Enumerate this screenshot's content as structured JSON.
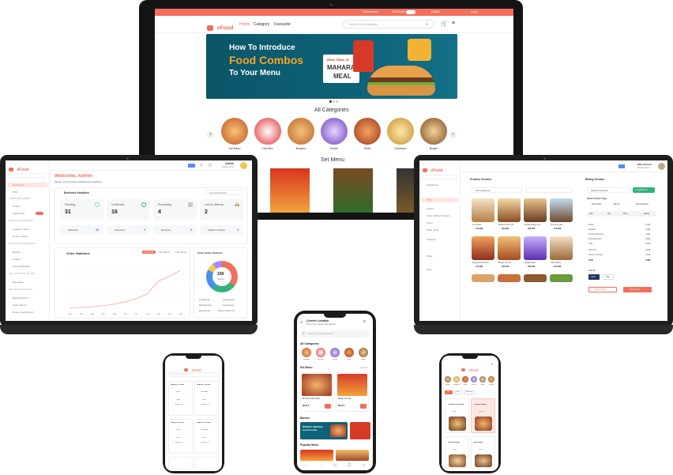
{
  "desktop": {
    "brand": "eFood",
    "nav": [
      "Home",
      "Category",
      "Favourite"
    ],
    "search_placeholder": "Search food & category...",
    "topbar": [
      "Restaurants",
      "Dark Mode",
      "English",
      "Login"
    ],
    "banner": {
      "line1": "How To Introduce",
      "line2": "Food Combos",
      "line3": "To Your Menu",
      "tag1": "REAL DEAL IS",
      "tag2": "MAHARAJA",
      "tag3": "MEAL"
    },
    "categories_title": "All Categories",
    "categories": [
      "Set Menu",
      "Hot Item",
      "Burgers",
      "Drinks",
      "Pizza",
      "Sandwich",
      "Burger"
    ],
    "set_menu_title": "Set Menu"
  },
  "admin": {
    "brand": "eFood",
    "welcome": "Welcome, Admin",
    "subtitle": "Monitor your business analytics and statistics",
    "analytics_title": "Business Analytics",
    "filter": "Overall Statistics",
    "user": "Admin",
    "role": "Master Admin",
    "stats": [
      {
        "label": "Pending",
        "value": "31"
      },
      {
        "label": "Confirmed",
        "value": "16"
      },
      {
        "label": "Processing",
        "value": "4"
      },
      {
        "label": "Out for delivery",
        "value": "2"
      }
    ],
    "sub_stats": [
      {
        "label": "Delivered",
        "value": "26"
      },
      {
        "label": "Canceled",
        "value": "2"
      },
      {
        "label": "Returned",
        "value": "2"
      },
      {
        "label": "Failed To Deliver",
        "value": "2"
      }
    ],
    "order_stats_title": "Order Statistics",
    "order_tabs": [
      "This Year",
      "This Month",
      "This Week"
    ],
    "months": [
      "Jan",
      "Feb",
      "Mar",
      "Apr",
      "May",
      "Jun",
      "Jul",
      "Aug",
      "Sep",
      "Oct",
      "Nov",
      "Dec"
    ],
    "donut_title": "Order Status Statistics",
    "donut_value": "159",
    "donut_label": "Orders",
    "sidebar": [
      "Dashboard",
      "POS",
      "Orders",
      "Table Order",
      "Category Setup",
      "Product Setup",
      "Banner",
      "Coupon",
      "Send Notification",
      "Messages",
      "Earning Report",
      "Order Report",
      "Deliveryman Report"
    ],
    "sidebar_sections": [
      "ORDER MANAGEMENT",
      "PRODUCT MANAGEMENT",
      "PROMOTION MANAGEMENT",
      "HELP & SUPPORT SECTION",
      "REPORT AND ANALYTICS"
    ],
    "legend": [
      "Pending (31)",
      "Ongoing (22)",
      "Delivered (26)",
      "Canceled (2)",
      "Returned (2)",
      "Failed to deliver (2)"
    ]
  },
  "pos": {
    "brand": "eFood",
    "product_section": "Product Section",
    "billing_section": "Billing Section",
    "category_select": "All Categories",
    "customer_select": "Select Customer",
    "add_customer": "+ Customer",
    "order_type_title": "Select Order Type",
    "order_types": [
      "Take Away",
      "Dine In",
      "Home Delivery"
    ],
    "table_headers": [
      "Item",
      "Qty",
      "Price",
      "Delete"
    ],
    "summary": [
      "Addon",
      "Subtotal",
      "Product Discount",
      "Extra Discount",
      "Total",
      "VAT/TAX",
      "Delivery Charge",
      "Total"
    ],
    "summary_values": [
      "0.00$",
      "0.00$",
      "0.00$",
      "0.00$",
      "0.00$",
      "0.00$",
      "0.00$",
      "0.00$"
    ],
    "paid_by": "Paid By",
    "paid_options": [
      "Cash",
      "Card"
    ],
    "cancel_order": "Cancel Order",
    "place_order": "Place Order",
    "products": [
      {
        "name": "Ice Cream",
        "price": "175.00$"
      },
      {
        "name": "Mother's Day Chi..",
        "price": "225.00$"
      },
      {
        "name": "Double Burger Co..",
        "price": "200.00$"
      },
      {
        "name": "Tea and Cake",
        "price": "120.00$"
      },
      {
        "name": "Pepperoni Pizza 6..",
        "price": "175.00$"
      },
      {
        "name": "Burger & Fries",
        "price": "250.00$"
      },
      {
        "name": "Vanilla Cake",
        "price": "200.00$"
      },
      {
        "name": "Cold Coffee",
        "price": "100.00$"
      }
    ],
    "sidebar": [
      "Dashboard",
      "POS",
      "Orders",
      "Verify Offline Payment",
      "Users",
      "Table Order",
      "Products",
      "Table",
      "Chat"
    ],
    "user": "Mike Bunnel",
    "role": "Branch Admin"
  },
  "phone_left": {
    "brand": "eFood",
    "search": "Search Orders By Table ID",
    "orders": [
      {
        "id": "Order ID # 100133",
        "type": "Dine In",
        "table": "Table 1",
        "date": "16 Aug 2023"
      },
      {
        "id": "Order ID # 100134",
        "type": "Take Away",
        "table": "Table 2",
        "date": "16 Aug 2023"
      },
      {
        "id": "Order ID # 100135",
        "type": "Dine In",
        "table": "Table 4",
        "date": "16 Aug 2023"
      },
      {
        "id": "Order ID # 100136",
        "type": "Take Away",
        "table": "Table 7",
        "date": "16 Aug 2023"
      }
    ]
  },
  "phone_center": {
    "location_title": "Current Location",
    "location": "Mirpur Sony Square, Bangladesh",
    "search": "Type your craving to discover...",
    "all_categories": "All Categories",
    "view_all": "View All",
    "categories": [
      "Set Menu",
      "Hot Item",
      "Drinks",
      "Pizza",
      "Burger"
    ],
    "set_menu": "Set Menu",
    "items": [
      {
        "name": "Premium Rice Bowl",
        "price": "$9.00 $"
      },
      {
        "name": "Burger & Fries",
        "price": "$8.00 $"
      }
    ],
    "banner_title": "Banner",
    "banner_text": "WEEKLY SPECIAL Food Combo",
    "popular_items": "Popular Items"
  },
  "phone_right": {
    "brand": "eFood",
    "categories": [
      "Burger",
      "Sandwich",
      "Pizza",
      "Drinks",
      "Coffee",
      "Chicken"
    ],
    "filters": [
      "All",
      "Veg",
      "Non Veg"
    ],
    "items": [
      "Chicken Fried Burger",
      "Premium Burger",
      "Chicken Burger",
      "Beef Burger"
    ],
    "item_subs": [
      "Burger",
      "Set Menu",
      "Burger",
      "Burger"
    ]
  },
  "colors": {
    "brand": "#f26f5c",
    "banner": "#0e6278",
    "bezel": "#1b1b1b",
    "accent_green": "#34b27a"
  }
}
